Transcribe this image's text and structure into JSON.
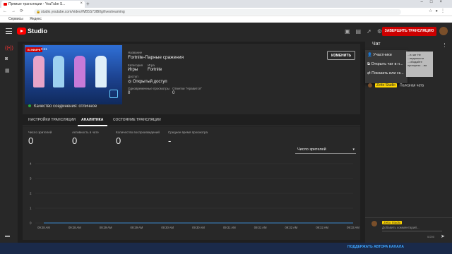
{
  "browser": {
    "tab_title": "Прямые трансляции - YouTube S...",
    "url": "studio.youtube.com/video/WB5S73lB0g/livestreaming",
    "bookmarks": [
      "Сервисы",
      "Яндекс"
    ]
  },
  "header": {
    "logo_text": "Studio",
    "end_stream_label": "ЗАВЕРШИТЬ ТРАНСЛЯЦИЮ"
  },
  "stream": {
    "live_badge": "В ЭФИРЕ",
    "timer": "0:41",
    "title_label": "Название",
    "title": "Fortnite-Парные сражения",
    "category_label": "Категория",
    "category": "Игры",
    "game_label": "Игра",
    "game": "Fortnite",
    "access_label": "Доступ",
    "access": "Открытый доступ",
    "viewers_label": "Одновременные просмотры",
    "viewers": "0",
    "likes_label": "Отметки \"Нравится\"",
    "likes": "0",
    "edit_label": "ИЗМЕНИТЬ",
    "quality": "Качество соединения: отличное"
  },
  "tabs": [
    {
      "label": "НАСТРОЙКИ ТРАНСЛЯЦИИ"
    },
    {
      "label": "АНАЛИТИКА"
    },
    {
      "label": "СОСТОЯНИЕ ТРАНСЛЯЦИИ"
    }
  ],
  "stats": [
    {
      "label": "Число зрителей",
      "value": "0"
    },
    {
      "label": "Активность в чате",
      "value": "0"
    },
    {
      "label": "Количество воспроизведений",
      "value": "0"
    },
    {
      "label": "Среднее время просмотра",
      "value": "-"
    }
  ],
  "metric_select": "Число зрителей",
  "chart_data": {
    "type": "line",
    "x": [
      "09:28 AM",
      "09:28 AM",
      "09:29 AM",
      "09:29 AM",
      "09:30 AM",
      "09:30 AM",
      "09:31 AM",
      "09:31 AM",
      "09:32 AM",
      "09:32 AM",
      "09:33 AM"
    ],
    "ylim": [
      0,
      4
    ],
    "yticks": [
      "0",
      "1",
      "2",
      "3",
      "4"
    ],
    "series": [
      {
        "values": [
          0,
          0,
          0,
          0,
          0,
          0,
          0,
          0,
          0,
          0,
          0
        ]
      }
    ],
    "grid": true
  },
  "chat": {
    "title": "Чат",
    "menu_items": [
      "Участники",
      "Открыть чат в н...",
      "Показать или ск..."
    ],
    "tooltip": "...в чат Не ...ведомости ...ободайте принципы ...ва",
    "message_name": "Zetto Studio",
    "message_text": "Полезная чата",
    "input_name": "Zetto Studio",
    "input_placeholder": "Добавить комментарий...",
    "char_count": "0/200"
  },
  "taskbar": {
    "text": "ПОДДЕРЖАТЬ АВТОРА КАНАЛА"
  },
  "colors": {
    "accent_red": "#cc0000",
    "background": "#1f1f1f",
    "card": "#282828",
    "quality_green": "#2ba640",
    "name_badge": "#ffd600"
  }
}
